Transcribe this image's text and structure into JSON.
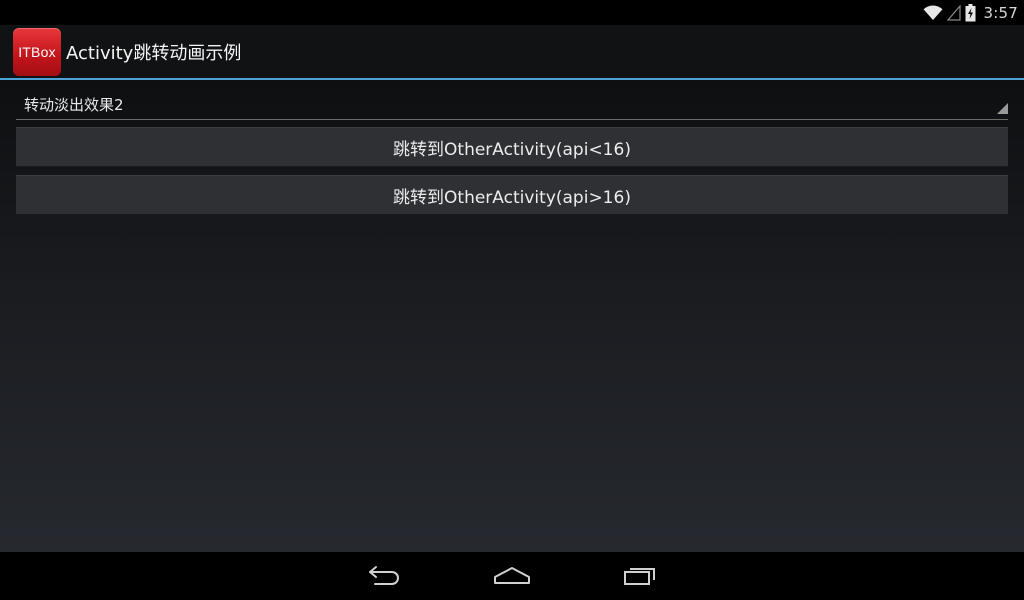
{
  "status_bar": {
    "time": "3:57",
    "icons": [
      "wifi-icon",
      "signal-icon",
      "battery-charging-icon"
    ]
  },
  "action_bar": {
    "app_icon_text": "ITBox",
    "title": "Activity跳转动画示例",
    "divider_color": "#4fa3d6",
    "app_icon_color": "#c4161c"
  },
  "spinner": {
    "selected": "转动淡出效果2"
  },
  "buttons": [
    {
      "label": "跳转到OtherActivity(api<16)"
    },
    {
      "label": "跳转到OtherActivity(api>16)"
    }
  ],
  "nav_bar": {
    "icons": [
      "back-icon",
      "home-icon",
      "recents-icon"
    ]
  }
}
